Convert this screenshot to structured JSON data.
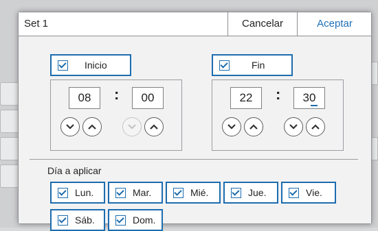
{
  "dialog": {
    "title": "Set 1",
    "cancel_label": "Cancelar",
    "accept_label": "Aceptar"
  },
  "start": {
    "label": "Inicio",
    "checked": true,
    "hour": "08",
    "minute": "00",
    "separator": ":"
  },
  "end": {
    "label": "Fin",
    "checked": true,
    "hour": "22",
    "minute": "30",
    "separator": ":"
  },
  "days": {
    "section_label": "Día a aplicar",
    "items": [
      {
        "label": "Lun.",
        "checked": true
      },
      {
        "label": "Mar.",
        "checked": true
      },
      {
        "label": "Mié.",
        "checked": true
      },
      {
        "label": "Jue.",
        "checked": true
      },
      {
        "label": "Vie.",
        "checked": true
      },
      {
        "label": "Sáb.",
        "checked": true
      },
      {
        "label": "Dom.",
        "checked": true
      }
    ]
  },
  "colors": {
    "accent": "#1c6cae",
    "accept_text": "#1e6fb8"
  },
  "icons": {
    "up": "chevron-up-icon",
    "down": "chevron-down-icon",
    "check": "checkmark-icon"
  }
}
